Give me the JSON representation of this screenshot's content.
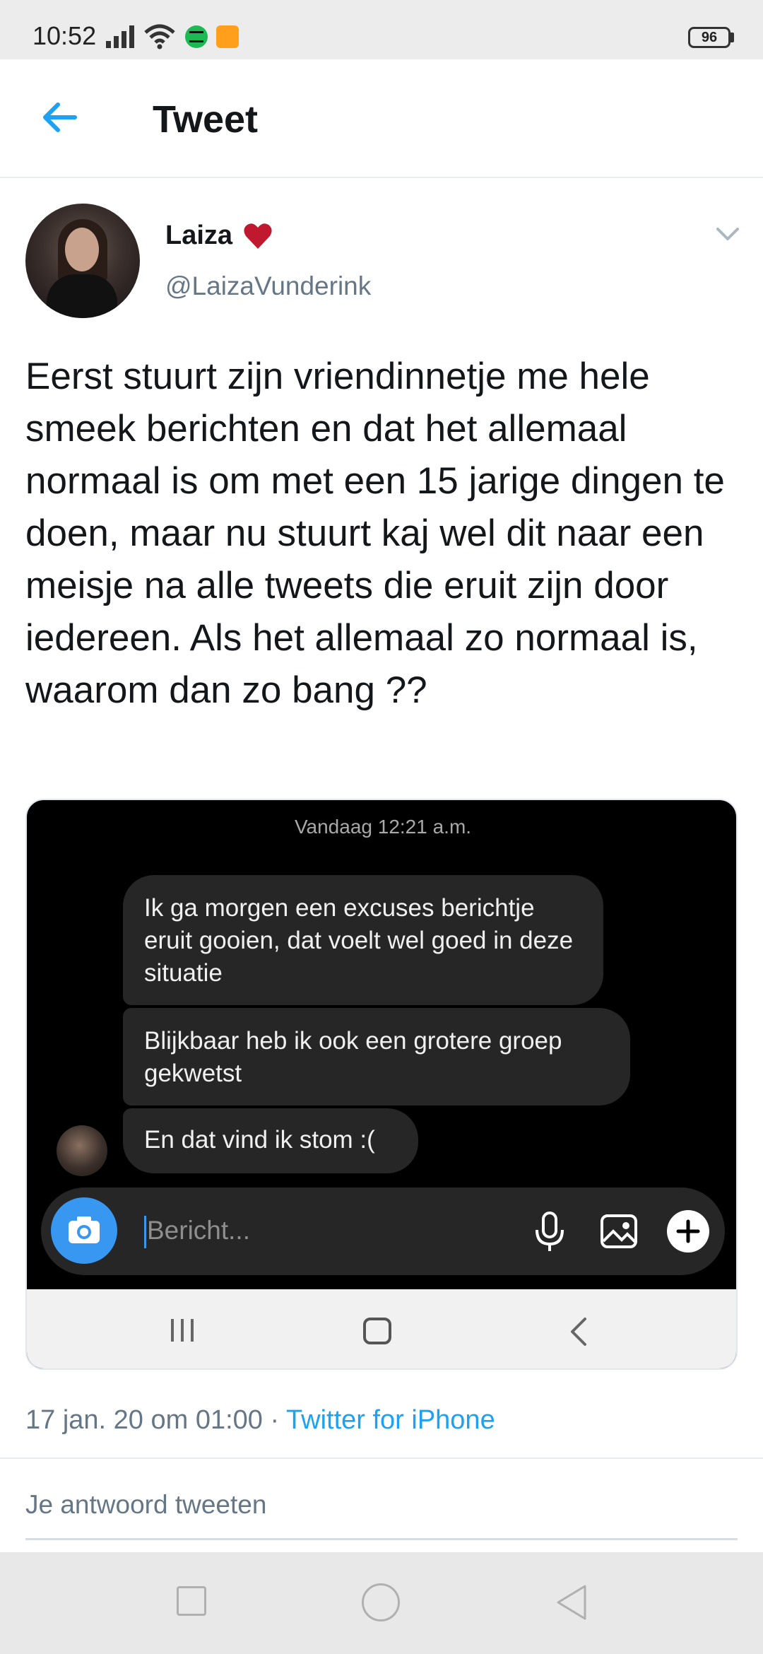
{
  "status_bar": {
    "time": "10:52",
    "battery": "96"
  },
  "header": {
    "title": "Tweet"
  },
  "tweet": {
    "display_name": "Laiza",
    "handle": "@LaizaVunderink",
    "text": "Eerst stuurt zijn vriendinnetje me hele smeek berichten en dat het allemaal normaal is om met een 15 jarige dingen te doen, maar nu stuurt kaj wel dit naar een meisje na alle tweets die eruit zijn door iedereen. Als het allemaal zo normaal is, waarom dan zo bang ??",
    "timestamp": "17 jan. 20 om 01:00",
    "separator": " · ",
    "source": "Twitter for iPhone"
  },
  "media": {
    "time": "Vandaag 12:21 a.m.",
    "messages": [
      "Ik ga morgen een excuses berichtje eruit gooien, dat voelt wel goed in deze situatie",
      "Blijkbaar heb ik ook een grotere groep gekwetst",
      "En dat vind ik stom :("
    ],
    "compose_placeholder": "Bericht..."
  },
  "reply": {
    "placeholder": "Je antwoord tweeten"
  },
  "colors": {
    "accent": "#1da1f2",
    "heart": "#e0245e",
    "secondary_text": "#657786",
    "dm_bubble": "#262626",
    "dm_camera": "#3897f0"
  }
}
